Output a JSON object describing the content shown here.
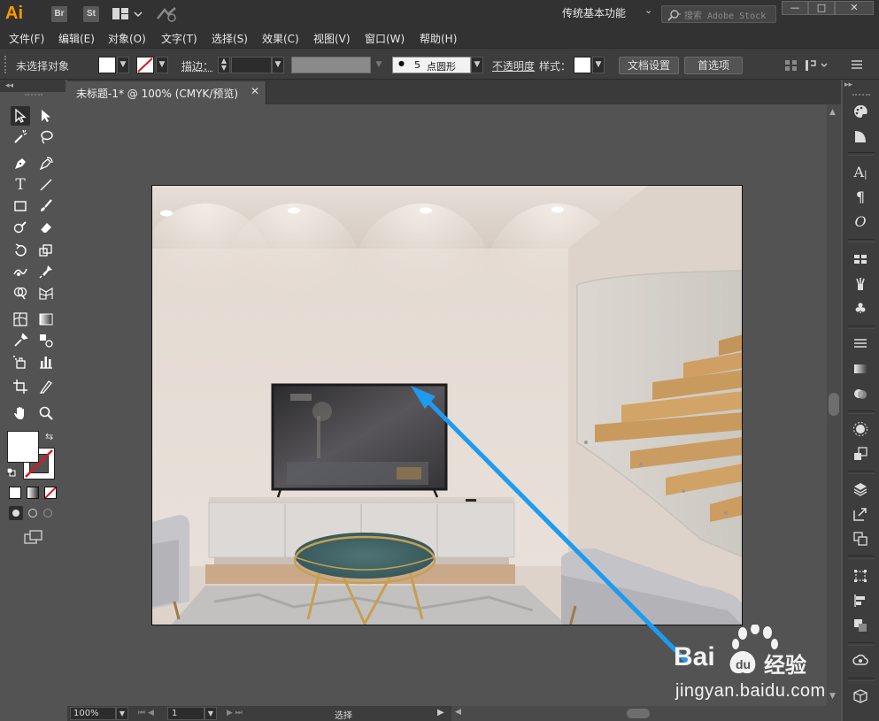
{
  "app": {
    "logo": "Ai",
    "bridge_label": "Br",
    "stock_label": "St",
    "workspace": "传统基本功能",
    "search_placeholder": "搜索 Adobe Stock",
    "window_buttons": {
      "minimize": "—",
      "restore": "□",
      "close": "✕"
    }
  },
  "menubar": {
    "items": [
      "文件(F)",
      "编辑(E)",
      "对象(O)",
      "文字(T)",
      "选择(S)",
      "效果(C)",
      "视图(V)",
      "窗口(W)",
      "帮助(H)"
    ]
  },
  "controlbar": {
    "selection_status": "未选择对象",
    "stroke_label": "描边：",
    "brush_dot": "●",
    "brush_size": "5",
    "brush_name": "点圆形",
    "opacity_label": "不透明度",
    "style_label": "样式：",
    "doc_settings": "文档设置",
    "preferences": "首选项"
  },
  "document": {
    "tab_title": "未标题-1* @ 100% (CMYK/预览)",
    "tab_close": "✕"
  },
  "statusbar": {
    "zoom": "100%",
    "artboard_number": "1",
    "tool_name": "选择"
  },
  "watermark": {
    "brand": "Bai",
    "brand_suffix": "经验",
    "url": "jingyan.baidu.com"
  },
  "colors": {
    "accent_arrow": "#1e9bf0",
    "logo": "#ff9a00",
    "chrome_dark": "#323232",
    "panel": "#535353"
  }
}
